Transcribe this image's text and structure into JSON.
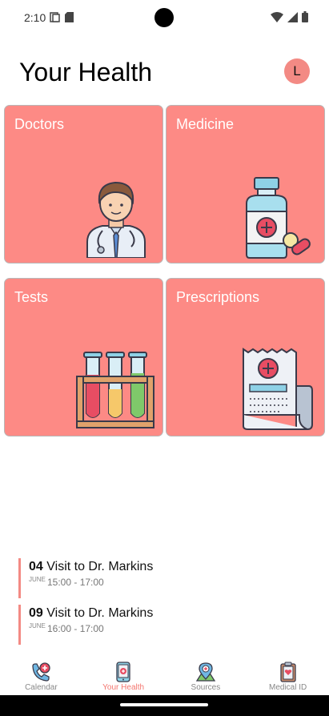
{
  "status_bar": {
    "time": "2:10"
  },
  "header": {
    "title": "Your Health",
    "avatar_initial": "L"
  },
  "cards": [
    {
      "label": "Doctors",
      "icon": "doctor-icon"
    },
    {
      "label": "Medicine",
      "icon": "medicine-bottle-icon"
    },
    {
      "label": "Tests",
      "icon": "test-tubes-icon"
    },
    {
      "label": "Prescriptions",
      "icon": "prescription-receipt-icon"
    }
  ],
  "appointments": [
    {
      "day": "04",
      "title": "Visit to Dr. Markins",
      "month": "JUNE",
      "time": "15:00 - 17:00"
    },
    {
      "day": "09",
      "title": "Visit to Dr. Markins",
      "month": "JUNE",
      "time": "16:00 - 17:00"
    }
  ],
  "bottom_nav": [
    {
      "label": "Calendar",
      "icon": "phone-plus-icon",
      "active": false
    },
    {
      "label": "Your Health",
      "icon": "phone-medical-icon",
      "active": true
    },
    {
      "label": "Sources",
      "icon": "map-pin-icon",
      "active": false
    },
    {
      "label": "Medical ID",
      "icon": "clipboard-heart-icon",
      "active": false
    }
  ],
  "colors": {
    "card": "#fd8a85",
    "accent": "#f38a84",
    "active_nav": "#f4766f"
  }
}
